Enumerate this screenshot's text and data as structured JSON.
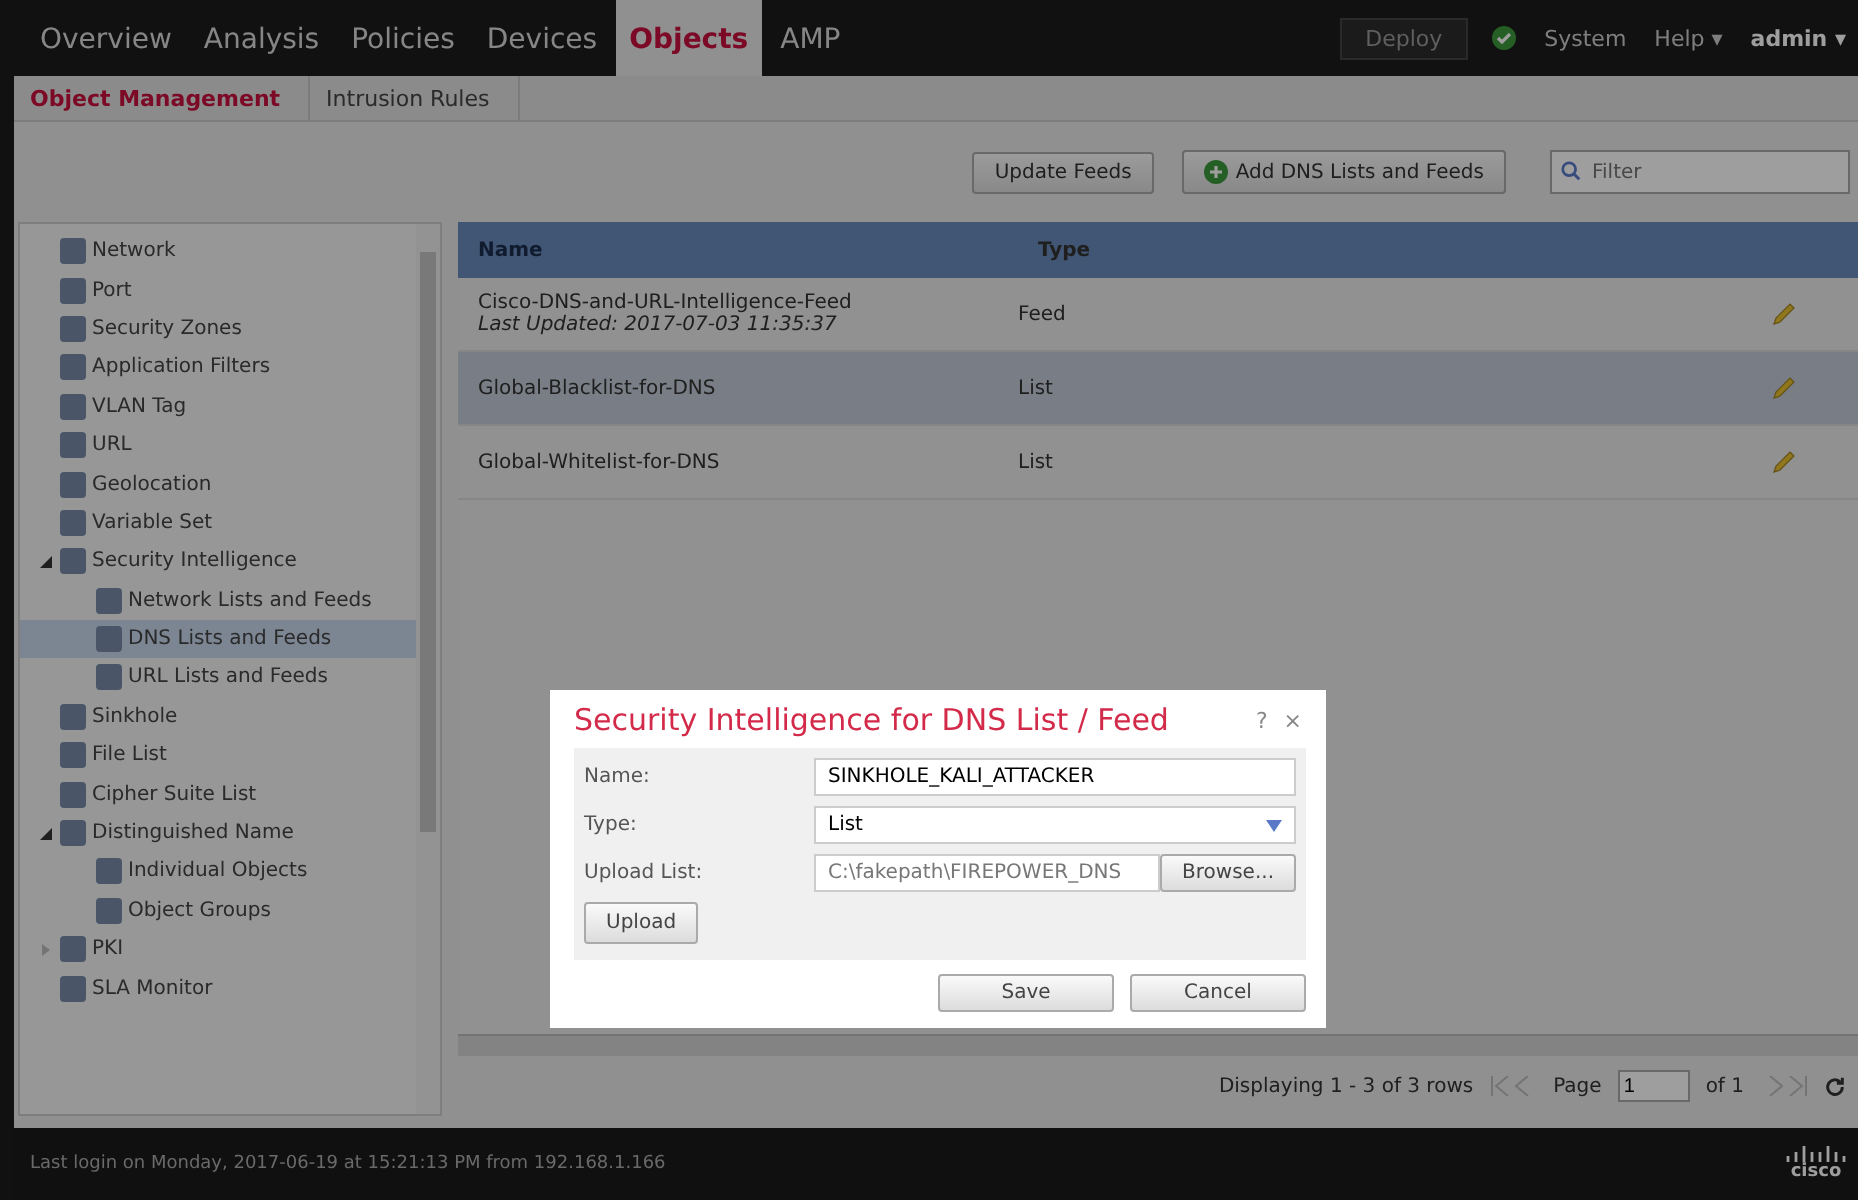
{
  "top_nav": {
    "tabs": [
      {
        "label": "Overview",
        "selected": false
      },
      {
        "label": "Analysis",
        "selected": false
      },
      {
        "label": "Policies",
        "selected": false
      },
      {
        "label": "Devices",
        "selected": false
      },
      {
        "label": "Objects",
        "selected": true
      },
      {
        "label": "AMP",
        "selected": false
      }
    ],
    "deploy": "Deploy",
    "menus": [
      "System",
      "Help ▾",
      "admin ▾"
    ]
  },
  "sub_tabs": [
    {
      "label": "Object Management",
      "selected": true
    },
    {
      "label": "Intrusion Rules",
      "selected": false
    }
  ],
  "toolbar": {
    "buttons": [
      "Update Feeds",
      "Add DNS Lists and Feeds"
    ],
    "filter": {
      "placeholder": "Filter"
    }
  },
  "sidebar": {
    "items": [
      {
        "label": "Network",
        "selected": false
      },
      {
        "label": "Port",
        "selected": false
      },
      {
        "label": "Security Zones",
        "selected": false
      },
      {
        "label": "Application Filters",
        "selected": false
      },
      {
        "label": "VLAN Tag",
        "selected": false
      },
      {
        "label": "URL",
        "selected": false
      },
      {
        "label": "Geolocation",
        "selected": false
      },
      {
        "label": "Variable Set",
        "selected": false
      },
      {
        "label": "Security Intelligence",
        "selected": false,
        "expanded": true,
        "children": [
          {
            "label": "Network Lists and Feeds",
            "selected": false
          },
          {
            "label": "DNS Lists and Feeds",
            "selected": true
          },
          {
            "label": "URL Lists and Feeds",
            "selected": false
          }
        ]
      },
      {
        "label": "Sinkhole",
        "selected": false
      },
      {
        "label": "File List",
        "selected": false
      },
      {
        "label": "Cipher Suite List",
        "selected": false
      },
      {
        "label": "Distinguished Name",
        "selected": false,
        "expanded": true,
        "children": [
          {
            "label": "Individual Objects",
            "selected": false
          },
          {
            "label": "Object Groups",
            "selected": false
          }
        ]
      },
      {
        "label": "PKI",
        "selected": false,
        "expanded": false
      },
      {
        "label": "SLA Monitor",
        "selected": false
      }
    ]
  },
  "table": {
    "columns": [
      "Name",
      "Type"
    ],
    "rows": [
      {
        "name": "Cisco-DNS-and-URL-Intelligence-Feed",
        "note": "Last Updated: 2017-07-03 11:35:37",
        "type": "Feed",
        "selected": false
      },
      {
        "name": "Global-Blacklist-for-DNS",
        "type": "List",
        "selected": true
      },
      {
        "name": "Global-Whitelist-for-DNS",
        "type": "List",
        "selected": false
      }
    ]
  },
  "pager": {
    "summary": "Displaying 1 - 3 of 3 rows",
    "page_label": "Page",
    "page": "1",
    "of": "of 1"
  },
  "footer": {
    "last_login": "Last login on Monday, 2017-06-19 at 15:21:13 PM from 192.168.1.166",
    "logo": "cisco"
  },
  "dialog": {
    "title": "Security Intelligence for DNS List / Feed",
    "help": "?",
    "close": "×",
    "fields": [
      {
        "kind": "text",
        "label": "Name:",
        "value": "SINKHOLE_KALI_ATTACKER"
      },
      {
        "kind": "select",
        "label": "Type:",
        "value": "List"
      },
      {
        "kind": "file",
        "label": "Upload List:",
        "value": "C:\\fakepath\\FIREPOWER_DNS",
        "button": "Browse..."
      }
    ],
    "upload": "Upload",
    "buttons": [
      "Save",
      "Cancel"
    ]
  }
}
